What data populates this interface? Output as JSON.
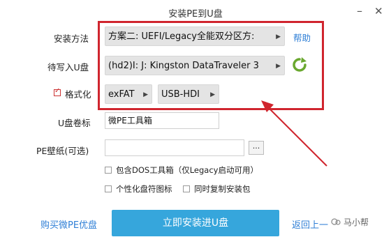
{
  "window": {
    "title": "安装PE到U盘"
  },
  "rows": {
    "install_method": {
      "label": "安装方法",
      "value": "方案二: UEFI/Legacy全能双分区方:",
      "help": "帮助"
    },
    "target_drive": {
      "label": "待写入U盘",
      "value": "(hd2)I: J: Kingston DataTraveler 3"
    },
    "format": {
      "label": "格式化",
      "checked": true,
      "fs": "exFAT",
      "mode": "USB-HDI"
    },
    "volume_label": {
      "label": "U盘卷标",
      "value": "微PE工具箱"
    },
    "wallpaper": {
      "label": "PE壁纸(可选)",
      "value": "",
      "browse": "..."
    }
  },
  "options": {
    "dos_toolbox": {
      "label": "包含DOS工具箱（仅Legacy启动可用）",
      "checked": false
    },
    "custom_icon": {
      "label": "个性化盘符图标",
      "checked": false
    },
    "copy_package": {
      "label": "同时复制安装包",
      "checked": false
    }
  },
  "footer": {
    "buy_link": "购买微PE优盘",
    "install_button": "立即安装进U盘",
    "back_link": "返回上一"
  },
  "watermark": {
    "text": "马小帮"
  },
  "colors": {
    "accent": "#36a6dc",
    "link": "#2f7fd6",
    "highlight": "#d0252e",
    "refresh": "#6aa82f"
  }
}
